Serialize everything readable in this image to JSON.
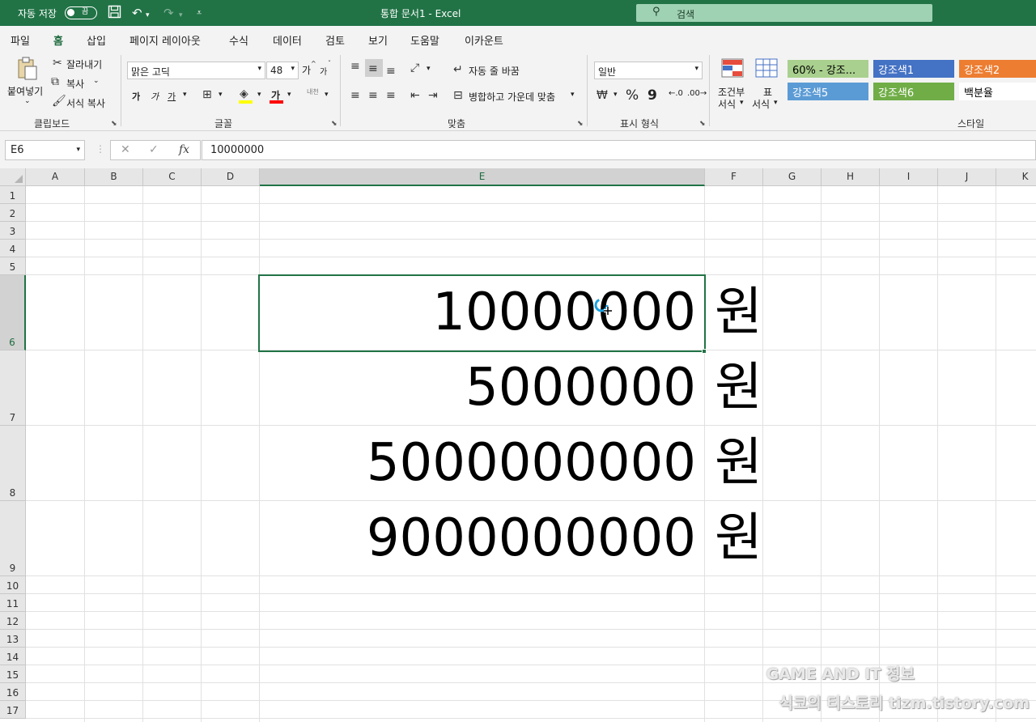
{
  "titlebar": {
    "autosave_label": "자동 저장",
    "autosave_state": "끔",
    "doc_title": "통합 문서1  -  Excel",
    "search_placeholder": "검색"
  },
  "ribbon_tabs": [
    "파일",
    "홈",
    "삽입",
    "페이지 레이아웃",
    "수식",
    "데이터",
    "검토",
    "보기",
    "도움말",
    "이카운트"
  ],
  "active_tab": "홈",
  "clipboard": {
    "paste": "붙여넣기",
    "cut": "잘라내기",
    "copy": "복사",
    "format_painter": "서식 복사",
    "group": "클립보드"
  },
  "font": {
    "name": "맑은 고딕",
    "size": "48",
    "grow": "가",
    "shrink": "가",
    "bold": "가",
    "italic": "가",
    "underline": "가",
    "color_glyph": "가",
    "phonetic": "내천",
    "group": "글꼴"
  },
  "alignment": {
    "wrap": "자동 줄 바꿈",
    "merge": "병합하고 가운데 맞춤",
    "group": "맞춤"
  },
  "number": {
    "format": "일반",
    "percent": "%",
    "comma": "9",
    "group": "표시 형식"
  },
  "styles": {
    "cond_format": [
      "조건부",
      "서식"
    ],
    "table_format": [
      "표",
      "서식"
    ],
    "chips": [
      {
        "label": "60% - 강조...",
        "color": "#a9d08e",
        "text": "#000000"
      },
      {
        "label": "강조색1",
        "color": "#4472c4",
        "text": "#ffffff"
      },
      {
        "label": "강조색2",
        "color": "#ed7d31",
        "text": "#ffffff"
      },
      {
        "label": "강조색5",
        "color": "#5b9bd5",
        "text": "#ffffff"
      },
      {
        "label": "강조색6",
        "color": "#70ad47",
        "text": "#ffffff"
      },
      {
        "label": "백분율",
        "color": "#ffffff",
        "text": "#000000"
      }
    ],
    "group": "스타일"
  },
  "formula_bar": {
    "name_box": "E6",
    "cancel": "✕",
    "enter": "✓",
    "fx": "fx",
    "value": "10000000"
  },
  "grid": {
    "columns": [
      "A",
      "B",
      "C",
      "D",
      "E",
      "F",
      "G",
      "H",
      "I",
      "J",
      "K"
    ],
    "selected_column": "E",
    "rows": [
      "1",
      "2",
      "3",
      "4",
      "5",
      "6",
      "7",
      "8",
      "9",
      "10",
      "11",
      "12",
      "13",
      "14",
      "15",
      "16",
      "17"
    ],
    "selected_row": "6",
    "cells": [
      {
        "row": "6",
        "value": "10000000",
        "unit": "원"
      },
      {
        "row": "7",
        "value": "5000000",
        "unit": "원"
      },
      {
        "row": "8",
        "value": "5000000000",
        "unit": "원"
      },
      {
        "row": "9",
        "value": "9000000000",
        "unit": "원"
      }
    ]
  },
  "watermark": {
    "line1": "GAME AND IT 정보",
    "line2": "식코의 티스토리 tizm.tistory.com"
  },
  "colors": {
    "excel_green": "#217346",
    "accent_selected": "#1e6b3f"
  }
}
